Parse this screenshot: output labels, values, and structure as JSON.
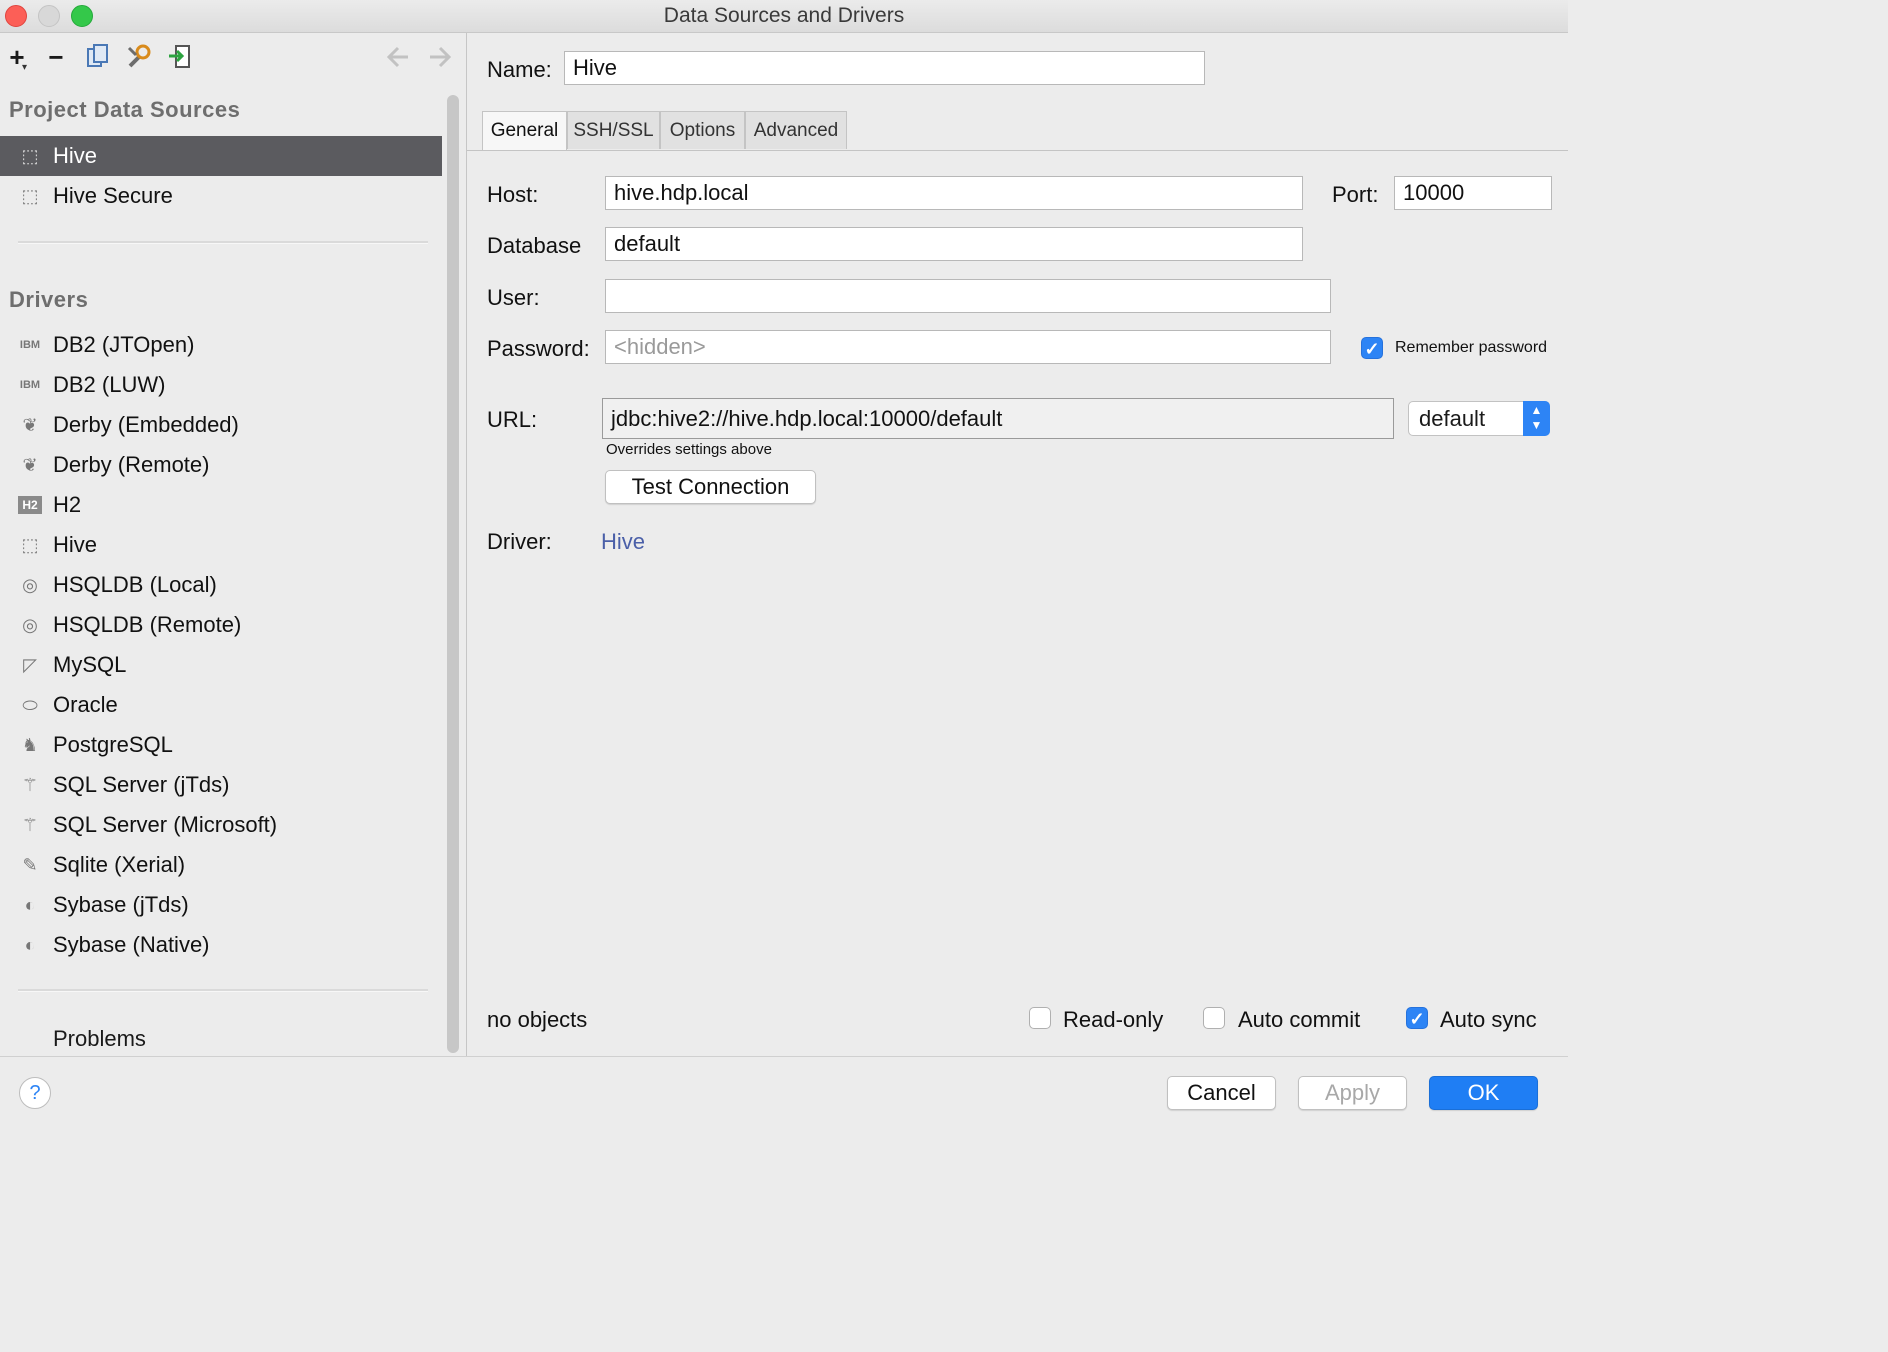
{
  "window": {
    "title": "Data Sources and Drivers"
  },
  "toolbar": {
    "add": "+",
    "remove": "−"
  },
  "left": {
    "project_title": "Project Data Sources",
    "project_items": [
      {
        "label": "Hive",
        "icon": "hive-icon",
        "selected": true
      },
      {
        "label": "Hive Secure",
        "icon": "hive-icon",
        "selected": false
      }
    ],
    "drivers_title": "Drivers",
    "driver_items": [
      {
        "label": "DB2 (JTOpen)",
        "icon": "ibm-icon",
        "glyph": "IBM"
      },
      {
        "label": "DB2 (LUW)",
        "icon": "ibm-icon",
        "glyph": "IBM"
      },
      {
        "label": "Derby (Embedded)",
        "icon": "feather-icon",
        "glyph": "❦"
      },
      {
        "label": "Derby (Remote)",
        "icon": "feather-icon",
        "glyph": "❦"
      },
      {
        "label": "H2",
        "icon": "h2-icon",
        "glyph": "H2"
      },
      {
        "label": "Hive",
        "icon": "hive-icon",
        "glyph": "⬚"
      },
      {
        "label": "HSQLDB (Local)",
        "icon": "hsqldb-icon",
        "glyph": "◎"
      },
      {
        "label": "HSQLDB (Remote)",
        "icon": "hsqldb-icon",
        "glyph": "◎"
      },
      {
        "label": "MySQL",
        "icon": "mysql-icon",
        "glyph": "◸"
      },
      {
        "label": "Oracle",
        "icon": "oracle-icon",
        "glyph": "⬭"
      },
      {
        "label": "PostgreSQL",
        "icon": "elephant-icon",
        "glyph": "♞"
      },
      {
        "label": "SQL Server (jTds)",
        "icon": "sqlserver-icon",
        "glyph": "⚚"
      },
      {
        "label": "SQL Server (Microsoft)",
        "icon": "sqlserver-icon",
        "glyph": "⚚"
      },
      {
        "label": "Sqlite (Xerial)",
        "icon": "quill-icon",
        "glyph": "✎"
      },
      {
        "label": "Sybase (jTds)",
        "icon": "sybase-icon",
        "glyph": "◐"
      },
      {
        "label": "Sybase (Native)",
        "icon": "sybase-icon",
        "glyph": "◐"
      }
    ],
    "problems": "Problems"
  },
  "right": {
    "name_label": "Name:",
    "name_value": "Hive",
    "tabs": [
      {
        "label": "General",
        "active": true
      },
      {
        "label": "SSH/SSL",
        "active": false
      },
      {
        "label": "Options",
        "active": false
      },
      {
        "label": "Advanced",
        "active": false
      }
    ],
    "host_label": "Host:",
    "host_value": "hive.hdp.local",
    "port_label": "Port:",
    "port_value": "10000",
    "database_label": "Database",
    "database_value": "default",
    "user_label": "User:",
    "user_value": "",
    "password_label": "Password:",
    "password_placeholder": "<hidden>",
    "remember_password": {
      "label": "Remember password",
      "checked": true
    },
    "url_label": "URL:",
    "url_value": "jdbc:hive2://hive.hdp.local:10000/default",
    "url_mode": "default",
    "url_hint": "Overrides settings above",
    "test_connection": "Test Connection",
    "driver_label": "Driver:",
    "driver_link": "Hive",
    "objects_status": "no objects",
    "read_only": {
      "label": "Read-only",
      "checked": false
    },
    "auto_commit": {
      "label": "Auto commit",
      "checked": false
    },
    "auto_sync": {
      "label": "Auto sync",
      "checked": true
    }
  },
  "footer": {
    "help": "?",
    "cancel": "Cancel",
    "apply": "Apply",
    "ok": "OK"
  },
  "colors": {
    "accent": "#2d84f5",
    "selection": "#5b5b5f",
    "link": "#4a5fa8"
  }
}
